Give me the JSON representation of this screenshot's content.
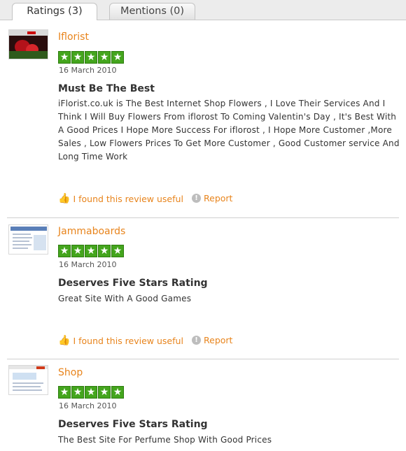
{
  "tabs": [
    {
      "label": "Ratings (3)",
      "active": true
    },
    {
      "label": "Mentions (0)",
      "active": false
    }
  ],
  "star_glyph": "★",
  "colors": {
    "accent": "#e8841c",
    "star_bg": "#44a51d"
  },
  "reviews": [
    {
      "site": "Iflorist",
      "rating": 5,
      "date": "16 March 2010",
      "heading": "Must Be The Best",
      "body": "iFlorist.co.uk is The Best Internet Shop Flowers , I Love Their Services And I Think I Will Buy Flowers From iflorost To Coming Valentin's Day , It's Best With A Good Prices I Hope More Success For iflorost , I Hope More Customer ,More Sales , Low Flowers Prices To Get More Customer , Good Customer service And Long Time Work",
      "useful_label": "I found this review useful",
      "report_label": "Report"
    },
    {
      "site": "Jammaboards",
      "rating": 5,
      "date": "16 March 2010",
      "heading": "Deserves Five Stars Rating",
      "body": "Great Site With A Good Games",
      "useful_label": "I found this review useful",
      "report_label": "Report"
    },
    {
      "site": "Shop",
      "rating": 5,
      "date": "16 March 2010",
      "heading": "Deserves Five Stars Rating",
      "body": "The Best Site For Perfume Shop With Good Prices"
    }
  ]
}
